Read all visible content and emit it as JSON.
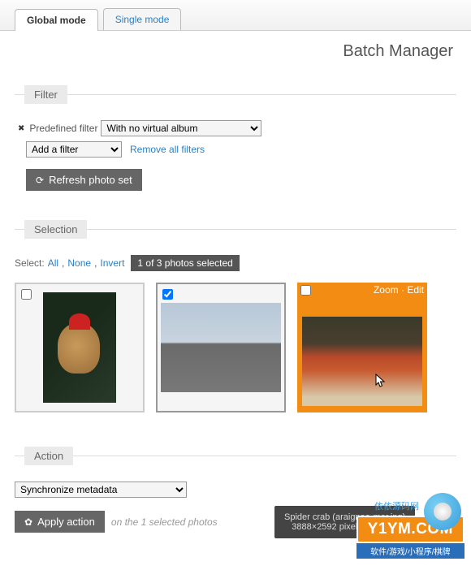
{
  "tabs": {
    "global": "Global mode",
    "single": "Single mode"
  },
  "page_title": "Batch Manager",
  "filter": {
    "legend": "Filter",
    "predefined_label": "Predefined filter",
    "predefined_value": "With no virtual album",
    "add_filter": "Add a filter",
    "remove_all": "Remove all filters",
    "refresh_btn": "Refresh photo set"
  },
  "selection": {
    "legend": "Selection",
    "label": "Select:",
    "all": "All",
    "none": "None",
    "invert": "Invert",
    "count": "1 of 3 photos selected",
    "hover_actions": {
      "zoom": "Zoom",
      "edit": "Edit"
    },
    "tooltip_line1": "Spider crab (araignee-mer.jpg)",
    "tooltip_line2": "3888×2592 pixels, 3.97MB"
  },
  "action": {
    "legend": "Action",
    "select_value": "Synchronize metadata",
    "apply_btn": "Apply action",
    "hint": "on the 1 selected photos"
  },
  "watermark": {
    "text": "Y1YM.COM",
    "sub": "软件/游戏/小程序/棋牌",
    "brand": "依依源码网"
  }
}
